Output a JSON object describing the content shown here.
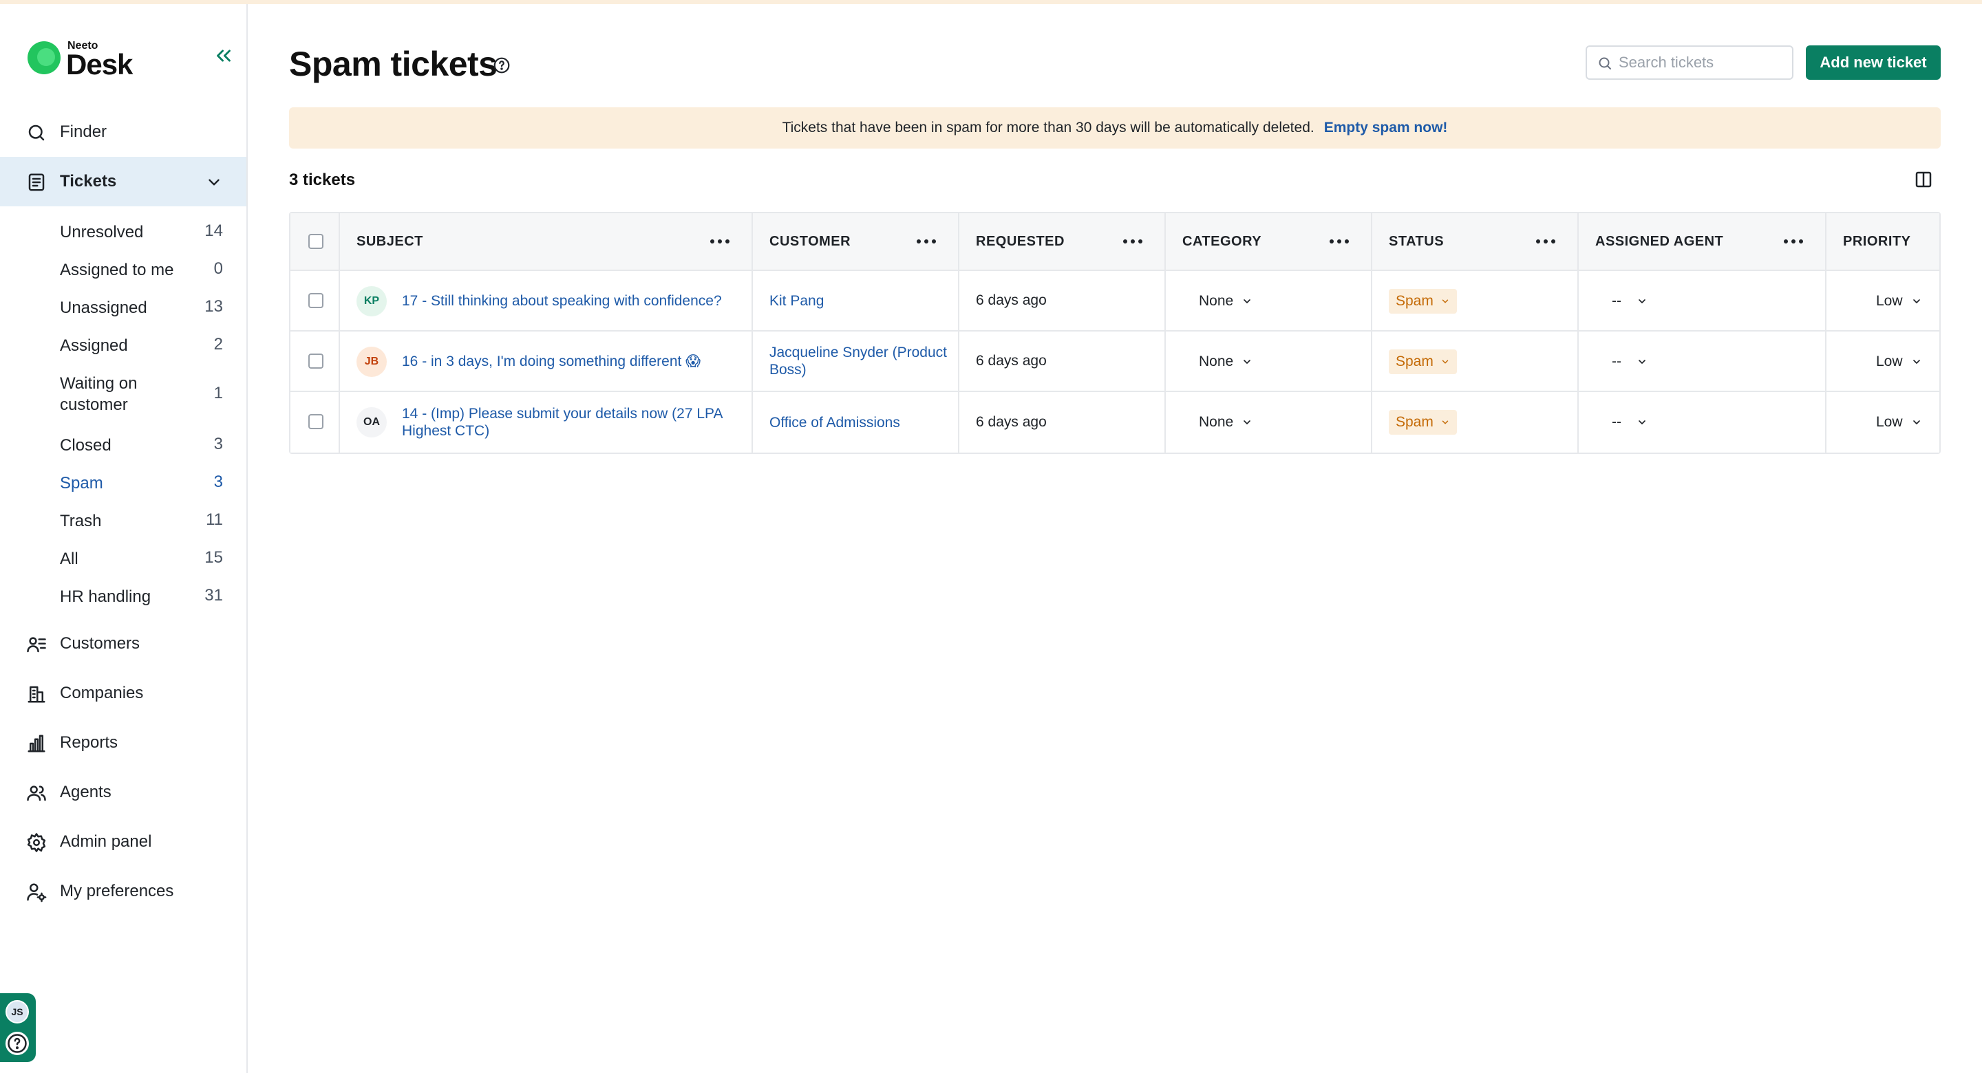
{
  "brand": {
    "small": "Neeto",
    "name": "Desk"
  },
  "sidebar": {
    "items": [
      {
        "label": "Finder",
        "icon": "search-icon"
      },
      {
        "label": "Tickets",
        "icon": "tickets-icon"
      },
      {
        "label": "Customers",
        "icon": "customers-icon"
      },
      {
        "label": "Companies",
        "icon": "companies-icon"
      },
      {
        "label": "Reports",
        "icon": "reports-icon"
      },
      {
        "label": "Agents",
        "icon": "agents-icon"
      },
      {
        "label": "Admin panel",
        "icon": "gear-icon"
      },
      {
        "label": "My preferences",
        "icon": "user-settings-icon"
      }
    ],
    "ticket_views": [
      {
        "label": "Unresolved",
        "count": "14"
      },
      {
        "label": "Assigned to me",
        "count": "0"
      },
      {
        "label": "Unassigned",
        "count": "13"
      },
      {
        "label": "Assigned",
        "count": "2"
      },
      {
        "label": "Waiting on customer",
        "count": "1"
      },
      {
        "label": "Closed",
        "count": "3"
      },
      {
        "label": "Spam",
        "count": "3"
      },
      {
        "label": "Trash",
        "count": "11"
      },
      {
        "label": "All",
        "count": "15"
      },
      {
        "label": "HR handling",
        "count": "31"
      }
    ],
    "user_initials": "JS"
  },
  "header": {
    "title": "Spam tickets",
    "search_placeholder": "Search tickets",
    "add_button": "Add new ticket"
  },
  "banner": {
    "text": "Tickets that have been in spam for more than 30 days will be automatically deleted.",
    "link": "Empty spam now!"
  },
  "table": {
    "count_label": "3 tickets",
    "columns": [
      "SUBJECT",
      "CUSTOMER",
      "REQUESTED",
      "CATEGORY",
      "STATUS",
      "ASSIGNED AGENT",
      "PRIORITY"
    ],
    "rows": [
      {
        "initials": "KP",
        "subject": "17 - Still thinking about speaking with confidence?",
        "customer": "Kit Pang",
        "requested": "6 days ago",
        "category": "None",
        "status": "Spam",
        "agent": "--",
        "priority": "Low"
      },
      {
        "initials": "JB",
        "subject": "16 - in 3 days, I'm doing something different 😱",
        "customer": "Jacqueline Snyder (Product Boss)",
        "requested": "6 days ago",
        "category": "None",
        "status": "Spam",
        "agent": "--",
        "priority": "Low"
      },
      {
        "initials": "OA",
        "subject": "14 - (Imp) Please submit your details now (27 LPA Highest CTC)",
        "customer": "Office of Admissions",
        "requested": "6 days ago",
        "category": "None",
        "status": "Spam",
        "agent": "--",
        "priority": "Low"
      }
    ]
  },
  "colors": {
    "accent": "#0a7f62",
    "link": "#1e5aa8",
    "banner_bg": "#fbeedc",
    "spam_text": "#c46a06",
    "active_nav_bg": "#e3eef7"
  }
}
